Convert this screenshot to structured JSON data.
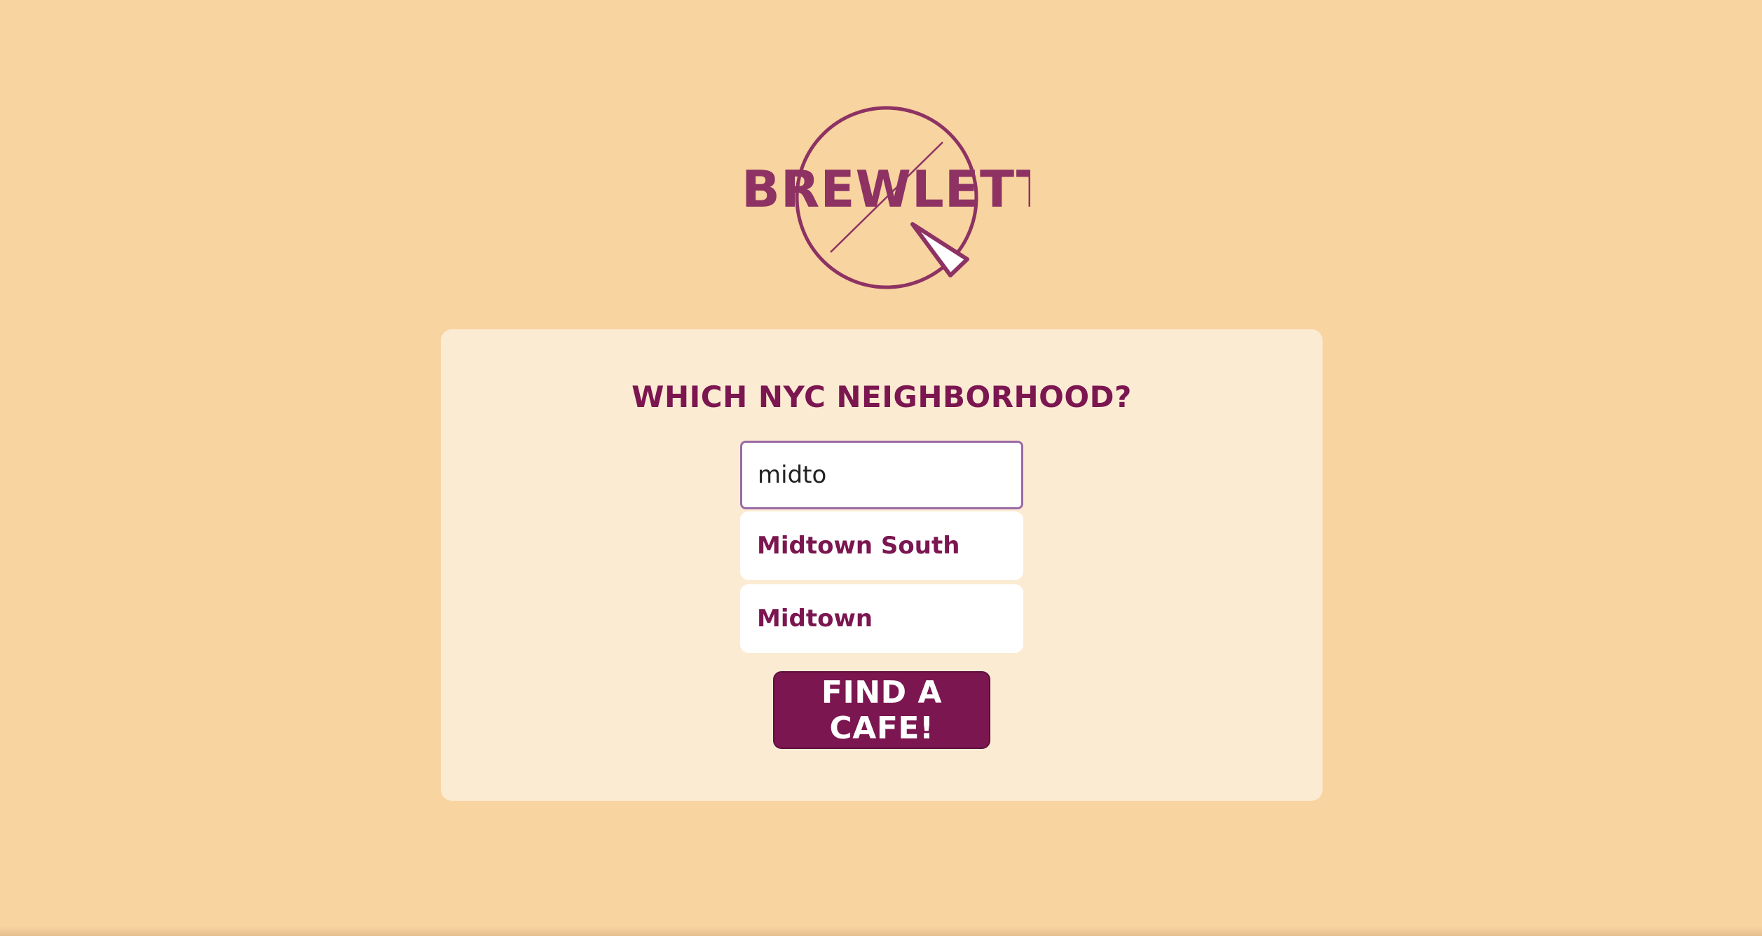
{
  "app": {
    "logo_text": "BREWLETTE",
    "colors": {
      "background": "#f8d4a0",
      "card": "#fcebd3",
      "accent": "#7b1650",
      "logo": "#8d3263"
    }
  },
  "form": {
    "heading": "WHICH NYC NEIGHBORHOOD?",
    "input_value": "midto",
    "suggestions": [
      "Midtown South",
      "Midtown"
    ],
    "submit_label": "FIND A CAFE!"
  }
}
